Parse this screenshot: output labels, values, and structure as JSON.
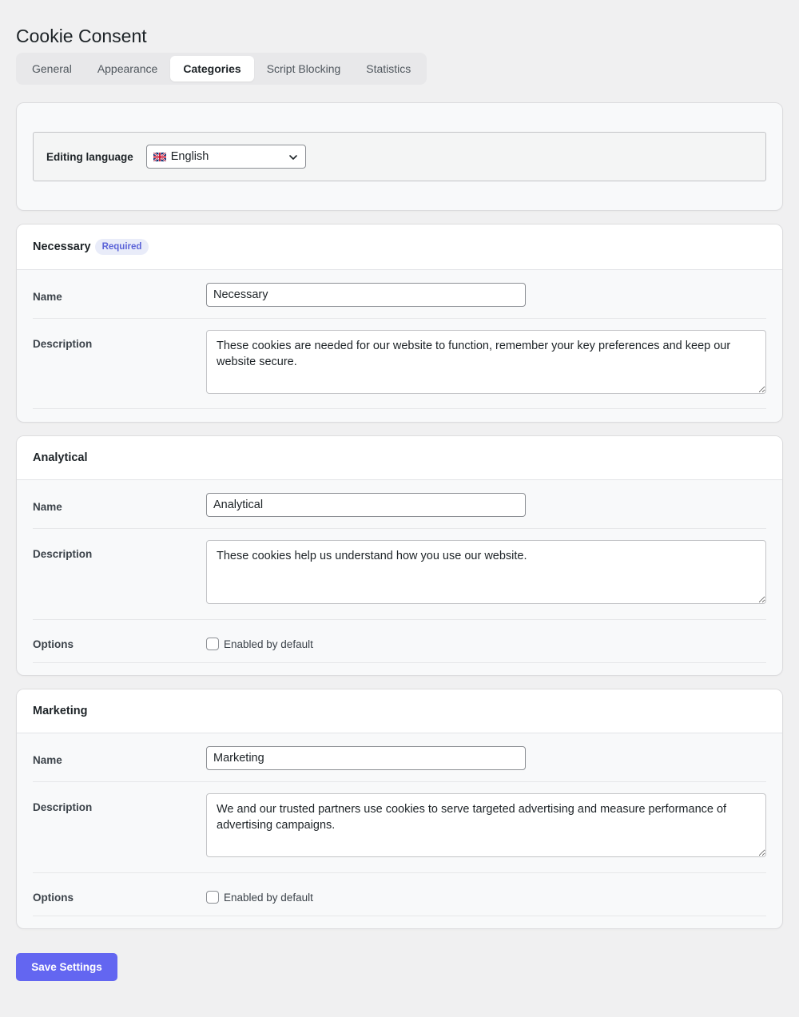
{
  "page": {
    "title": "Cookie Consent"
  },
  "tabs": [
    {
      "label": "General"
    },
    {
      "label": "Appearance"
    },
    {
      "label": "Categories"
    },
    {
      "label": "Script Blocking"
    },
    {
      "label": "Statistics"
    }
  ],
  "active_tab": "Categories",
  "language": {
    "label": "Editing language",
    "selected": "English",
    "flag": "uk-flag-icon"
  },
  "categories": [
    {
      "title": "Necessary",
      "badge": "Required",
      "name_label": "Name",
      "name_value": "Necessary",
      "description_label": "Description",
      "description_value": "These cookies are needed for our website to function, remember your key preferences and keep our website secure."
    },
    {
      "title": "Analytical",
      "name_label": "Name",
      "name_value": "Analytical",
      "description_label": "Description",
      "description_value": "These cookies help us understand how you use our website.",
      "options_label": "Options",
      "option_text": "Enabled by default",
      "enabled": false
    },
    {
      "title": "Marketing",
      "name_label": "Name",
      "name_value": "Marketing",
      "description_label": "Description",
      "description_value": "We and our trusted partners use cookies to serve targeted advertising and measure performance of advertising campaigns.",
      "options_label": "Options",
      "option_text": "Enabled by default",
      "enabled": false
    }
  ],
  "save_label": "Save Settings",
  "colors": {
    "accent": "#6366f1",
    "badge_bg": "#e9ecf9",
    "badge_text": "#5b63d8",
    "page_bg": "#f0f0f1"
  }
}
